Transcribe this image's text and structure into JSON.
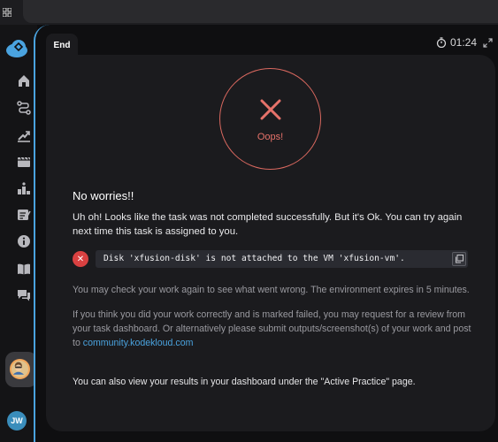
{
  "topbar": {
    "grid_icon": "grid-icon"
  },
  "sidebar": {
    "items": [
      {
        "name": "home",
        "icon": "home-icon"
      },
      {
        "name": "roadmap",
        "icon": "route-icon"
      },
      {
        "name": "progress",
        "icon": "chart-up-icon"
      },
      {
        "name": "videos",
        "icon": "film-icon"
      },
      {
        "name": "leaderboard",
        "icon": "podium-icon"
      },
      {
        "name": "notes",
        "icon": "notes-icon"
      },
      {
        "name": "info",
        "icon": "info-icon"
      },
      {
        "name": "library",
        "icon": "book-icon"
      },
      {
        "name": "chat",
        "icon": "chat-icon"
      }
    ],
    "user_initials": "JW"
  },
  "panel": {
    "tab_label": "End",
    "timer": "01:24"
  },
  "result": {
    "status_text": "Oops!",
    "title": "No worries!!",
    "message": "Uh oh! Looks like the task was not completed successfully. But it's Ok. You can try again next time this task is assigned to you.",
    "error": "Disk 'xfusion-disk' is not attached to the VM 'xfusion-vm'.",
    "check_again": "You may check your work again to see what went wrong. The environment expires in 5 minutes.",
    "review_text": "If you think you did your work correctly and is marked failed, you may request for a review from your task dashboard. Or alternatively please submit outputs/screenshot(s) of your work and post to ",
    "community_link": "community.kodekloud.com",
    "dashboard_text": "You can also view your results in your dashboard under the \"Active Practice\" page."
  },
  "colors": {
    "accent": "#4aa3df",
    "error": "#e6726a",
    "panel_bg": "#1b1b1e"
  }
}
